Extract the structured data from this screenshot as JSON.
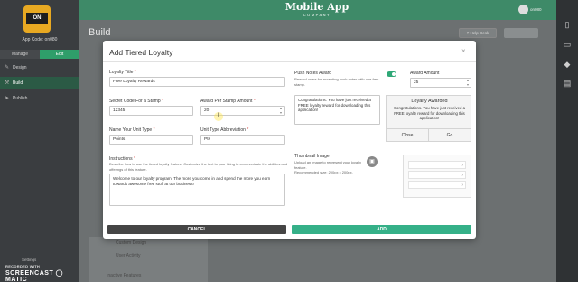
{
  "sidebar": {
    "logo_text": "ON",
    "app_code": "App Code: on080",
    "modes": [
      "Manage",
      "Edit"
    ],
    "nav": [
      {
        "label": "Design",
        "icon": "brush-icon"
      },
      {
        "label": "Build",
        "icon": "wrench-icon"
      },
      {
        "label": "Publish",
        "icon": "send-icon"
      }
    ],
    "settings": "Settings"
  },
  "watermark": {
    "line1": "RECORDED WITH",
    "line2": "SCREENCAST ◯ MATIC"
  },
  "header": {
    "brand": "Mobile App",
    "brand_sub": "COMPANY",
    "user": "on080"
  },
  "page": {
    "title": "Build",
    "help_desk": "? Help Desk",
    "bg_items": [
      "Custom Design",
      "User Activity",
      "Inactive Features"
    ]
  },
  "modal": {
    "title": "Add Tiered Loyalty",
    "close": "×",
    "fields": {
      "loyalty_title": {
        "label": "Loyalty Title",
        "value": "Free Loyalty Rewards"
      },
      "secret_code": {
        "label": "Secret Code For a Stamp",
        "value": "12345"
      },
      "award_per_stamp": {
        "label": "Award Per Stamp Amount",
        "value": "20"
      },
      "unit_type": {
        "label": "Name Your Unit Type",
        "value": "Points"
      },
      "unit_abbr": {
        "label": "Unit Type Abbreviation",
        "value": "Pts"
      },
      "instructions": {
        "label": "Instructions",
        "help": "Describe how to use the tiered loyalty feature. Customize the text to your liking to communicate the abilities and offerings of this feature.",
        "value": "Welcome to our loyalty program! The more you come in and spend the more you earn towards awesome free stuff at our business!"
      },
      "push_notes": {
        "label": "Push Notes Award",
        "help": "Reward users for accepting push notes with one free stamp.",
        "value": "Congratulations. You have just received a FREE loyalty reward for downloading this application!",
        "enabled": true
      },
      "award_amount": {
        "label": "Award Amount",
        "value": "25"
      },
      "thumbnail": {
        "label": "Thumbnail Image",
        "help": "Upload an image to represent your loyalty feature.",
        "help2": "Recommended size: 200px x 200px."
      }
    },
    "preview": {
      "title": "Loyalty Awarded",
      "message": "Congratulations. You have just received a FREE loyalty reward for downloading this application!",
      "close": "Close",
      "go": "Go"
    },
    "buttons": {
      "cancel": "CANCEL",
      "add": "ADD"
    }
  },
  "colors": {
    "brand_green": "#3e8a68",
    "add_button": "#35b088",
    "cancel_button": "#454545",
    "logo_orange": "#e8a922"
  }
}
